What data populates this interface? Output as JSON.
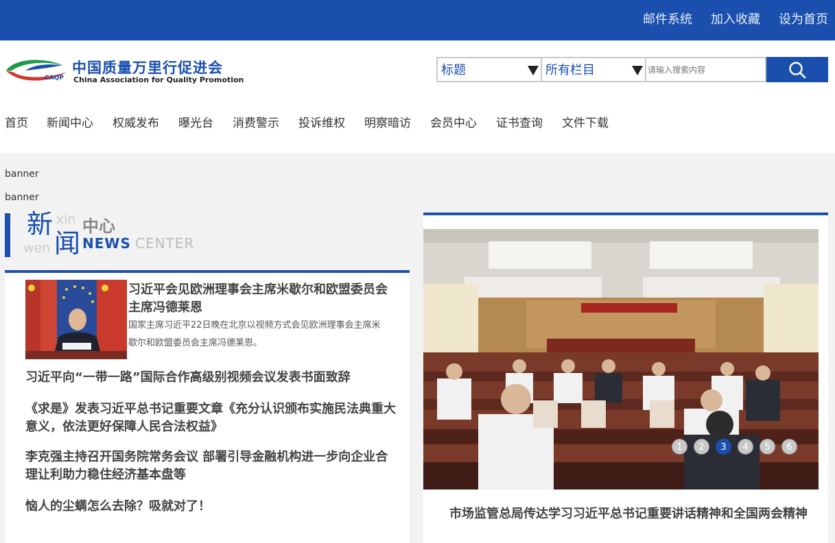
{
  "topbar": {
    "links": [
      "邮件系统",
      "加入收藏",
      "设为首页"
    ]
  },
  "logo": {
    "name_cn": "中国质量万里行促进会",
    "name_en": "China Association for Quality Promotion",
    "abbr": "CAQP"
  },
  "search": {
    "field_select": "标题",
    "column_select": "所有栏目",
    "placeholder": "请输入搜索内容"
  },
  "nav": {
    "items": [
      "首页",
      "新闻中心",
      "权威发布",
      "曝光台",
      "消费警示",
      "投诉维权",
      "明察暗访",
      "会员中心",
      "证书查询",
      "文件下载"
    ]
  },
  "banners": [
    "banner",
    "banner"
  ],
  "news_section": {
    "char1": "新",
    "char2": "闻",
    "pinyin1": "xin",
    "pinyin2": "wen",
    "title_cn": "中心",
    "title_en1": "NEWS",
    "title_en2": "CENTER"
  },
  "featured": {
    "title": "习近平会见欧洲理事会主席米歇尔和欧盟委员会主席冯德莱恩",
    "summary": "国家主席习近平22日晚在北京以视频方式会见欧洲理事会主席米歇尔和欧盟委员会主席冯德莱恩。"
  },
  "news_list": [
    "习近平向“一带一路”国际合作高级别视频会议发表书面致辞",
    "《求是》发表习近平总书记重要文章《充分认识颁布实施民法典重大意义，依法更好保障人民合法权益》",
    "李克强主持召开国务院常务会议 部署引导金融机构进一步向企业合理让利助力稳住经济基本盘等",
    "恼人的尘螨怎么去除？吸就对了！"
  ],
  "slider": {
    "pages": [
      "1",
      "2",
      "3",
      "4",
      "5",
      "6"
    ],
    "active_page": 3,
    "caption": "市场监管总局传达学习习近平总书记重要讲话精神和全国两会精神"
  },
  "colors": {
    "brand_blue": "#1a4fae",
    "page_bg": "#f2f2f2"
  }
}
